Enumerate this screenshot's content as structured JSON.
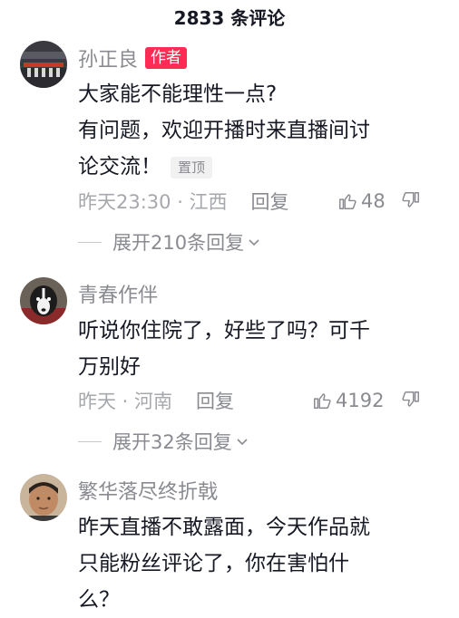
{
  "header": {
    "title": "2833 条评论"
  },
  "comments": [
    {
      "username": "孙正良",
      "badge": "作者",
      "content_lines": [
        "大家能不能理性一点?",
        "有问题，欢迎开播时来直播间讨",
        "论交流！"
      ],
      "pin_label": "置顶",
      "time_location": "昨天23:30 · 江西",
      "reply_label": "回复",
      "likes": "48",
      "expand_label": "展开210条回复"
    },
    {
      "username": "青春作伴",
      "content_lines": [
        "听说你住院了，好些了吗？可千",
        "万别好"
      ],
      "time_location": "昨天 · 河南",
      "reply_label": "回复",
      "likes": "4192",
      "expand_label": "展开32条回复"
    },
    {
      "username": "繁华落尽终折戟",
      "content_lines": [
        "昨天直播不敢露面，今天作品就",
        "只能粉丝评论了，你在害怕什",
        "么？"
      ]
    }
  ],
  "colors": {
    "brand": "#fe2c55",
    "text": "#161823",
    "secondary": "#8a8b91"
  },
  "icons": [
    "like-icon",
    "dislike-icon",
    "chevron-down-icon"
  ]
}
